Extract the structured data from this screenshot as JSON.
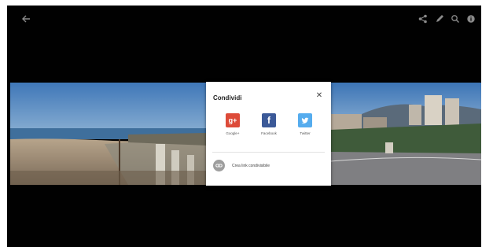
{
  "viewer": {
    "icons": {
      "back": "back-arrow-icon",
      "share": "share-icon",
      "edit": "edit-icon",
      "zoom": "zoom-icon",
      "info": "info-icon"
    }
  },
  "share_dialog": {
    "title": "Condividi",
    "close_glyph": "✕",
    "options": [
      {
        "label": "Google+",
        "logo_text": "g+",
        "color": "#dd4b39",
        "icon": "google-plus-icon"
      },
      {
        "label": "Facebook",
        "logo_text": "f",
        "color": "#3b5998",
        "icon": "facebook-icon"
      },
      {
        "label": "Twitter",
        "logo_text": "t",
        "color": "#55acee",
        "icon": "twitter-icon"
      }
    ],
    "link_label": "Crea link condivisibile",
    "link_icon": "link-icon",
    "link_icon_color": "#9e9e9e"
  }
}
